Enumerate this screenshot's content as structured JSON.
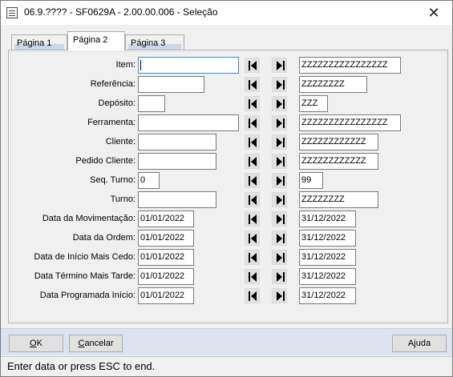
{
  "window": {
    "title": "06.9.???? - SF0629A - 2.00.00.006 - Seleção"
  },
  "tabs": [
    {
      "label": "Página 1"
    },
    {
      "label": "Página 2"
    },
    {
      "label": "Página 3"
    }
  ],
  "rows": [
    {
      "label": "Item:",
      "from": "",
      "to": "ZZZZZZZZZZZZZZZZ"
    },
    {
      "label": "Referência:",
      "from": "",
      "to": "ZZZZZZZZ"
    },
    {
      "label": "Depósito:",
      "from": "",
      "to": "ZZZ"
    },
    {
      "label": "Ferramenta:",
      "from": "",
      "to": "ZZZZZZZZZZZZZZZZ"
    },
    {
      "label": "Cliente:",
      "from": "",
      "to": "ZZZZZZZZZZZZ"
    },
    {
      "label": "Pedido Cliente:",
      "from": "",
      "to": "ZZZZZZZZZZZZ"
    },
    {
      "label": "Seq. Turno:",
      "from": "0",
      "to": "99"
    },
    {
      "label": "Turno:",
      "from": "",
      "to": "ZZZZZZZZ"
    },
    {
      "label": "Data da Movimentação:",
      "from": "01/01/2022",
      "to": "31/12/2022"
    },
    {
      "label": "Data da Ordem:",
      "from": "01/01/2022",
      "to": "31/12/2022"
    },
    {
      "label": "Data de Início Mais Cedo:",
      "from": "01/01/2022",
      "to": "31/12/2022"
    },
    {
      "label": "Data Término Mais Tarde:",
      "from": "01/01/2022",
      "to": "31/12/2022"
    },
    {
      "label": "Data Programada Início:",
      "from": "01/01/2022",
      "to": "31/12/2022"
    }
  ],
  "nav_icons": {
    "first": "first-record-icon",
    "last": "last-record-icon"
  },
  "buttons": {
    "ok": {
      "mnemonic": "O",
      "rest": "K"
    },
    "cancel": {
      "mnemonic": "C",
      "rest": "ancelar"
    },
    "help": {
      "pre": "A",
      "mnemonic": "j",
      "rest": "uda"
    }
  },
  "status": {
    "text": "Enter data or press ESC to end."
  },
  "colors": {
    "focus_border": "#3c8ad8",
    "bottom_bar": "#dde3ef"
  }
}
